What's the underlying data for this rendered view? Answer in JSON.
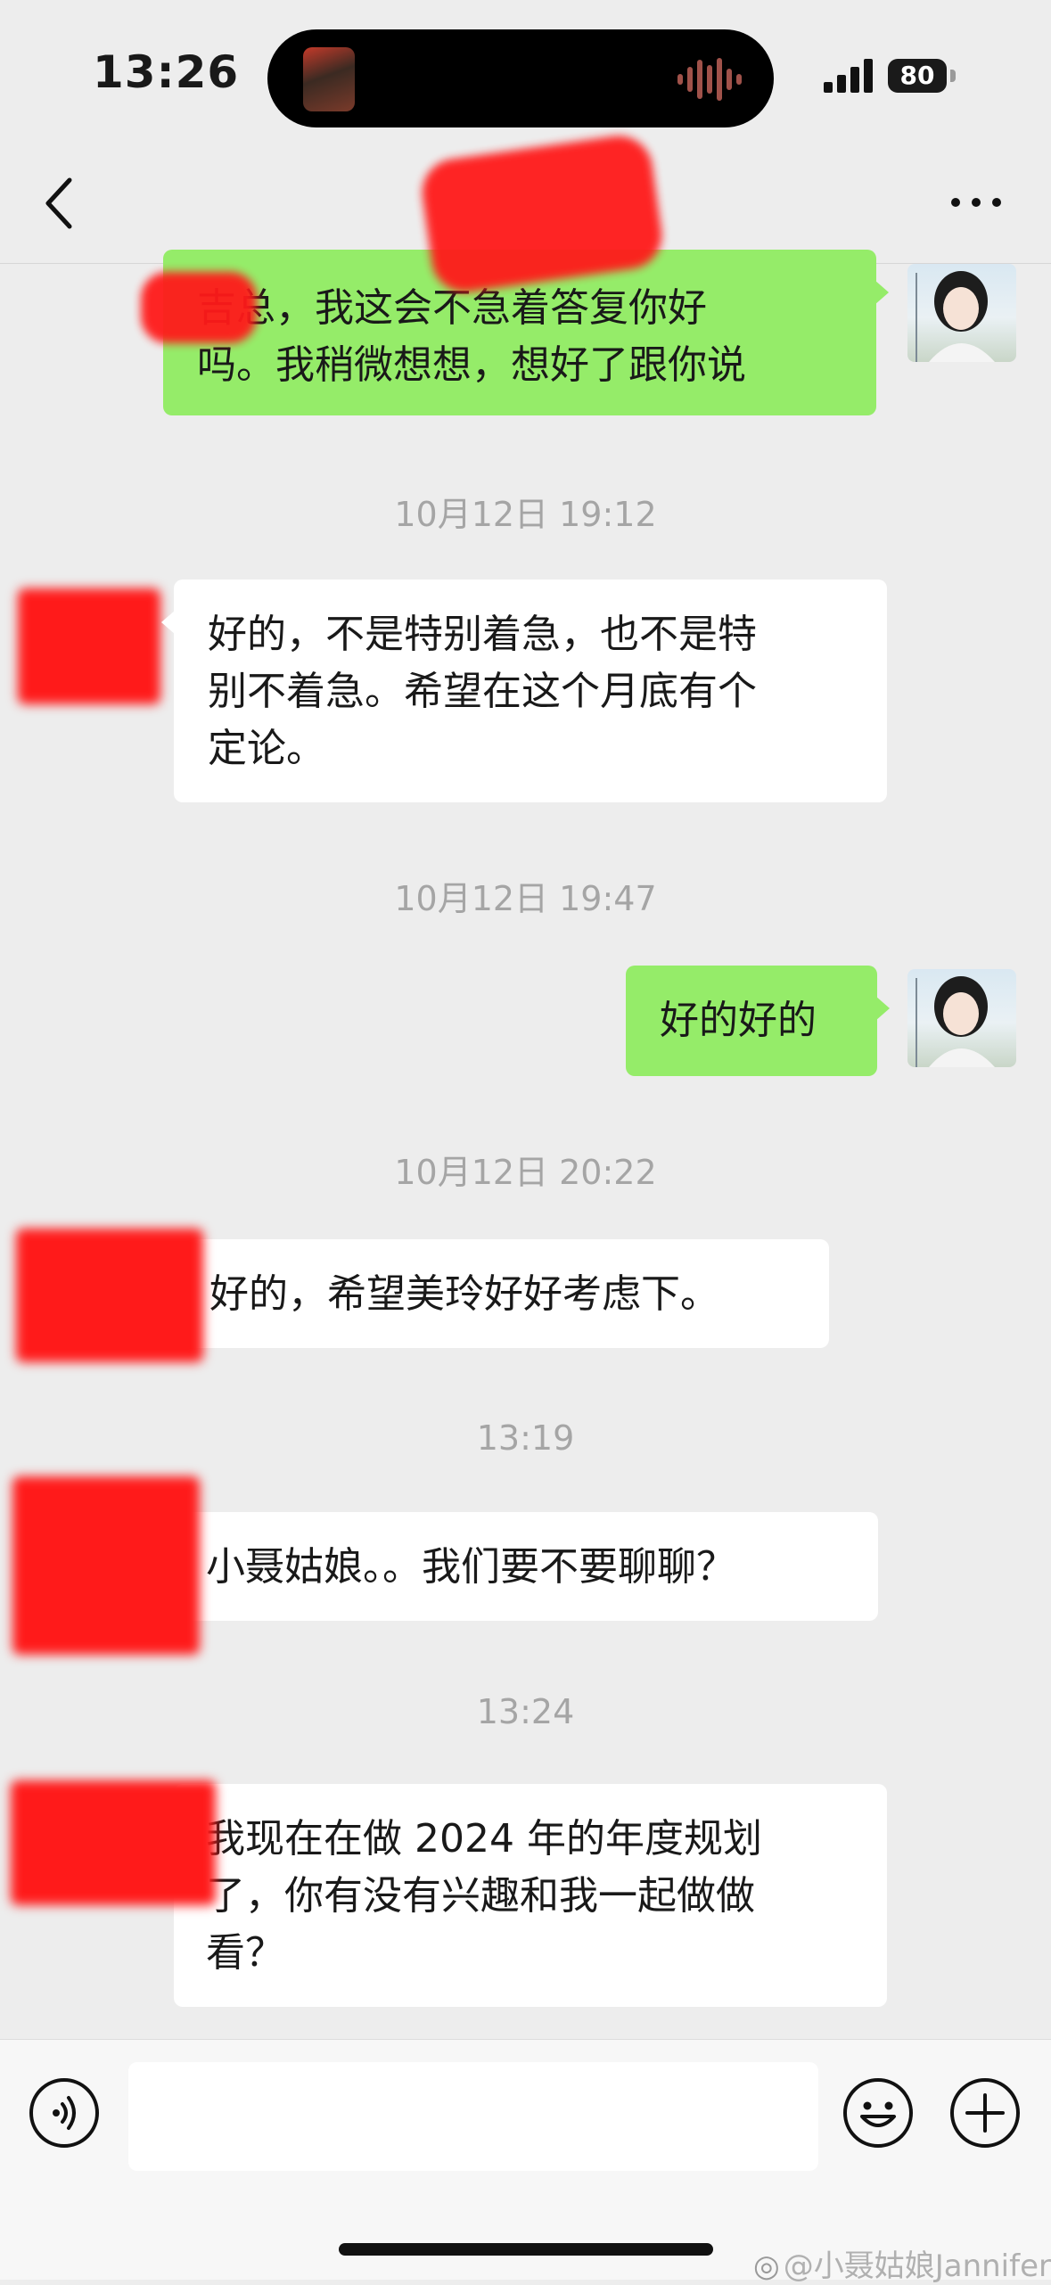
{
  "status_bar": {
    "time": "13:26",
    "battery": "80"
  },
  "nav": {
    "title": "",
    "back_icon": "chevron-left-icon",
    "more_icon": "ellipsis-icon"
  },
  "messages": [
    {
      "type": "text",
      "side": "me",
      "text": "吉总，我这会不急着答复你好\n吗。我稍微想想，想好了跟你说"
    },
    {
      "type": "time",
      "text": "10月12日 19:12"
    },
    {
      "type": "text",
      "side": "other",
      "text": "好的，不是特别着急，也不是特\n别不着急。希望在这个月底有个\n定论。"
    },
    {
      "type": "time",
      "text": "10月12日 19:47"
    },
    {
      "type": "text",
      "side": "me",
      "text": "好的好的"
    },
    {
      "type": "time",
      "text": "10月12日 20:22"
    },
    {
      "type": "text",
      "side": "other",
      "text": "好的，希望美玲好好考虑下。"
    },
    {
      "type": "time",
      "text": "13:19"
    },
    {
      "type": "text",
      "side": "other",
      "text": "小聂姑娘。。我们要不要聊聊？"
    },
    {
      "type": "time",
      "text": "13:24"
    },
    {
      "type": "text",
      "side": "other",
      "text": "我现在在做 2024 年的年度规划\n了，你有没有兴趣和我一起做做\n看？"
    }
  ],
  "input_bar": {
    "voice_icon": "voice-icon",
    "emoji_icon": "emoji-icon",
    "plus_icon": "plus-icon",
    "input_value": ""
  },
  "watermark": {
    "text": "@小聂姑娘Jannifer"
  },
  "colors": {
    "my_bubble": "#95ec69",
    "other_bubble": "#ffffff",
    "background": "#ededed",
    "redaction": "#ff1a1a"
  }
}
